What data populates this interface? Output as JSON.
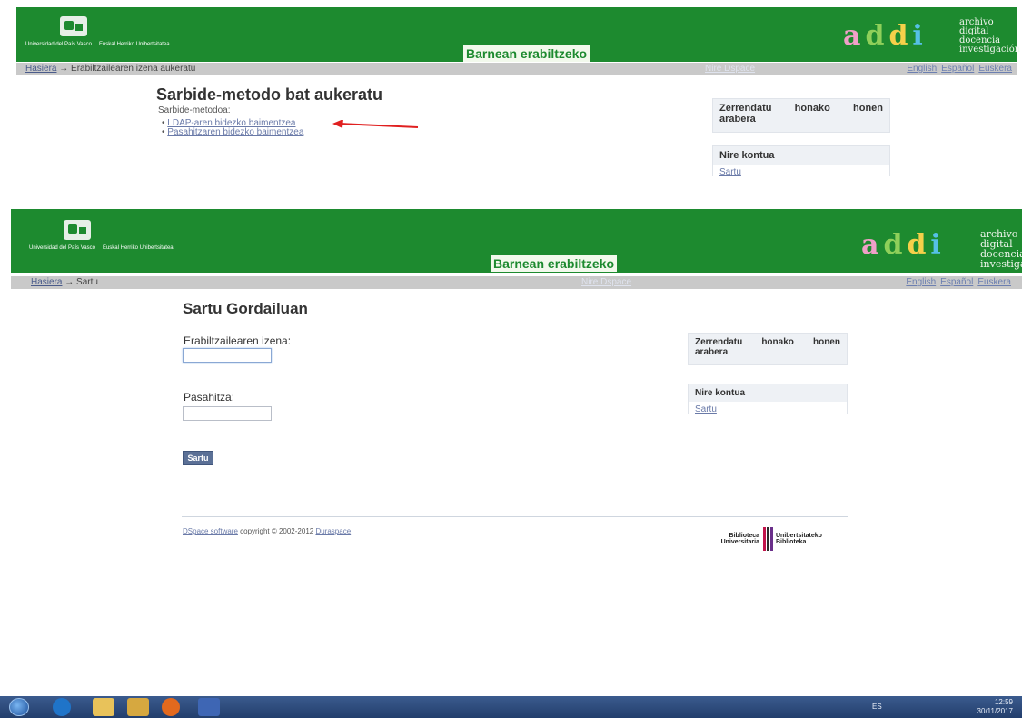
{
  "screen1": {
    "banner": "Barnean erabiltzeko",
    "logo_text": [
      "Universidad del País Vasco",
      "Euskal Herriko Unibertsitatea"
    ],
    "addi_brand": "addi",
    "addi_tagline": [
      "archivo",
      "digital",
      "docencia",
      "investigación"
    ],
    "breadcrumb": {
      "home": "Hasiera",
      "sep": "→",
      "current": "Erabiltzailearen izena aukeratu"
    },
    "nav_center": "Nire Dspace",
    "languages": [
      "English",
      "Español",
      "Euskera"
    ],
    "title": "Sarbide-metodo bat aukeratu",
    "subtitle": "Sarbide-metodoa:",
    "methods": [
      "LDAP-aren bidezko baimentzea",
      "Pasahitzaren bidezko baimentzea"
    ],
    "sidebar": {
      "list_words": [
        "Zerrendatu",
        "honako",
        "honen"
      ],
      "list_word2": "arabera",
      "account_head": "Nire kontua",
      "account_link": "Sartu"
    },
    "arrow_color": "#e02020"
  },
  "screen2": {
    "banner": "Barnean erabiltzeko",
    "breadcrumb": {
      "home": "Hasiera",
      "sep": "→",
      "current": "Sartu"
    },
    "nav_center": "Nire Dspace",
    "languages": [
      "English",
      "Español",
      "Euskera"
    ],
    "title": "Sartu Gordailuan",
    "username_label": "Erabiltzailearen izena:",
    "password_label": "Pasahitza:",
    "submit": "Sartu",
    "sidebar": {
      "list_words": [
        "Zerrendatu",
        "honako",
        "honen"
      ],
      "list_word2": "arabera",
      "account_head": "Nire kontua",
      "account_link": "Sartu"
    },
    "footer": {
      "link1": "DSpace software",
      "text": "copyright © 2002-2012",
      "link2": "Duraspace"
    },
    "library_left": [
      "Biblioteca",
      "Universitaria"
    ],
    "library_right": [
      "Unibertsitateko",
      "Biblioteka"
    ]
  },
  "taskbar": {
    "lang": "ES",
    "time": "12:59",
    "date": "30/11/2017"
  },
  "colors": {
    "header_green": "#1d8a2f",
    "navbar_gray": "#c9c9c9",
    "button_blue": "#5b7096"
  }
}
